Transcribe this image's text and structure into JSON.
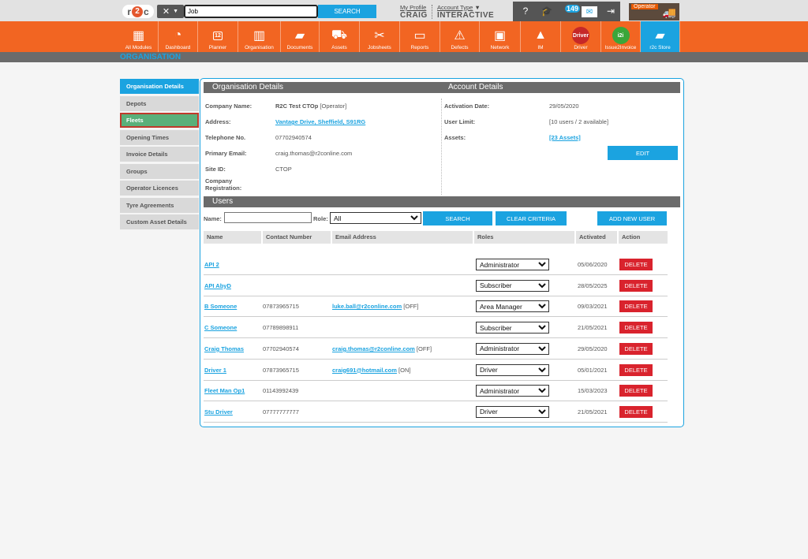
{
  "topbar": {
    "search_value": "Job",
    "search_button": "SEARCH",
    "my_profile": "My Profile",
    "user_name": "CRAIG",
    "account_type_label": "Account Type",
    "account_type_value": "INTERACTIVE",
    "notification_count": "149",
    "operator_label": "Operator"
  },
  "modules": [
    {
      "label": "All Modules",
      "icon": "grid-icon"
    },
    {
      "label": "Dashboard",
      "icon": "gauge-icon"
    },
    {
      "label": "Planner",
      "icon": "calendar-icon",
      "badge": "12"
    },
    {
      "label": "Organisation",
      "icon": "building-icon"
    },
    {
      "label": "Documents",
      "icon": "folder-icon"
    },
    {
      "label": "Assets",
      "icon": "truck-icon"
    },
    {
      "label": "Jobsheets",
      "icon": "tools-icon"
    },
    {
      "label": "Reports",
      "icon": "clipboard-icon"
    },
    {
      "label": "Defects",
      "icon": "warning-icon"
    },
    {
      "label": "Network",
      "icon": "contact-book-icon"
    },
    {
      "label": "IM",
      "icon": "im-icon"
    },
    {
      "label": "Driver",
      "icon": "driver-icon",
      "badge": "Driver"
    },
    {
      "label": "Issue2Invoice",
      "icon": "i2i-icon",
      "badge": "i2i"
    },
    {
      "label": "r2c Store",
      "icon": "briefcase-icon"
    }
  ],
  "section_title": "ORGANISATION",
  "sidebar": [
    "Organisation Details",
    "Depots",
    "Fleets",
    "Opening Times",
    "Invoice Details",
    "Groups",
    "Operator Licences",
    "Tyre Agreements",
    "Custom Asset Details"
  ],
  "org": {
    "header": "Organisation Details",
    "company_name_label": "Company Name:",
    "company_name": "R2C Test CTOp",
    "company_type": "[Operator]",
    "address_label": "Address:",
    "address": "Vantage Drive, Sheffield, S91RG",
    "telephone_label": "Telephone No.",
    "telephone": "07702940574",
    "email_label": "Primary Email:",
    "email": "craig.thomas@r2conline.com",
    "site_id_label": "Site ID:",
    "site_id": "CTOP",
    "company_reg_label_1": "Company",
    "company_reg_label_2": "Registration:"
  },
  "account": {
    "header": "Account Details",
    "activation_label": "Activation Date:",
    "activation_date": "29/05/2020",
    "user_limit_label": "User Limit:",
    "user_limit": "[10 users / 2 available]",
    "assets_label": "Assets:",
    "assets": "[23 Assets]",
    "edit_button": "EDIT"
  },
  "users": {
    "header": "Users",
    "name_label": "Name:",
    "name_value": "",
    "role_label": "Role:",
    "role_value": "All",
    "search_button": "SEARCH",
    "clear_button": "CLEAR CRITERIA",
    "add_button": "ADD NEW USER",
    "columns": [
      "Name",
      "Contact Number",
      "Email Address",
      "Roles",
      "Activated",
      "Action"
    ],
    "delete_label": "DELETE",
    "rows": [
      {
        "name": "API 2",
        "phone": "",
        "email": "",
        "status": "",
        "role": "Administrator",
        "activated": "05/06/2020"
      },
      {
        "name": "API AbyD",
        "phone": "",
        "email": "",
        "status": "",
        "role": "Subscriber",
        "activated": "28/05/2025"
      },
      {
        "name": "B Someone",
        "phone": "07873965715",
        "email": "luke.ball@r2conline.com",
        "status": "[OFF]",
        "role": "Area Manager",
        "activated": "09/03/2021"
      },
      {
        "name": "C Someone",
        "phone": "07789898911",
        "email": "",
        "status": "",
        "role": "Subscriber",
        "activated": "21/05/2021"
      },
      {
        "name": "Craig Thomas",
        "phone": "07702940574",
        "email": "craig.thomas@r2conline.com",
        "status": "[OFF]",
        "role": "Administrator",
        "activated": "29/05/2020"
      },
      {
        "name": "Driver 1",
        "phone": "07873965715",
        "email": "craig691@hotmail.com",
        "status": "[ON]",
        "role": "Driver",
        "activated": "05/01/2021"
      },
      {
        "name": "Fleet Man Op1",
        "phone": "01143992439",
        "email": "",
        "status": "",
        "role": "Administrator",
        "activated": "15/03/2023"
      },
      {
        "name": "Stu Driver",
        "phone": "07777777777",
        "email": "",
        "status": "",
        "role": "Driver",
        "activated": "21/05/2021"
      }
    ]
  }
}
